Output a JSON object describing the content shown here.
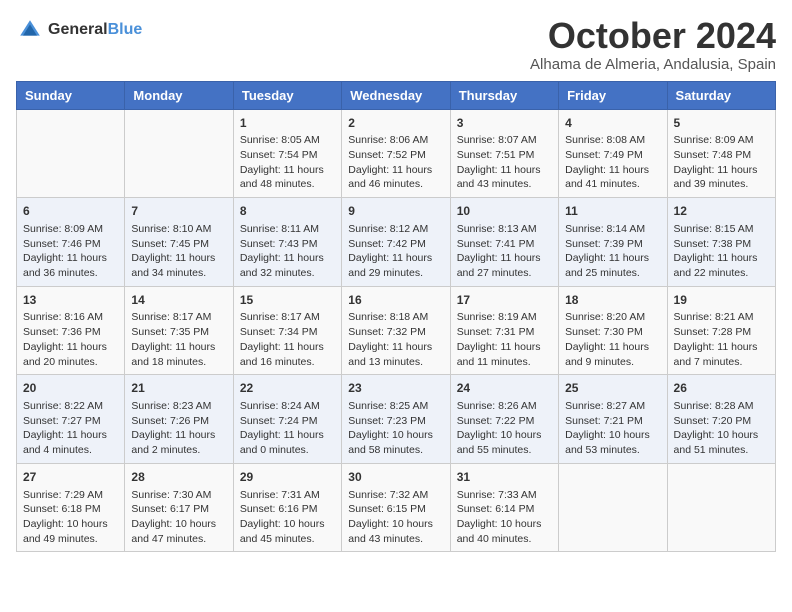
{
  "logo": {
    "line1": "General",
    "line2": "Blue"
  },
  "title": "October 2024",
  "subtitle": "Alhama de Almeria, Andalusia, Spain",
  "days_of_week": [
    "Sunday",
    "Monday",
    "Tuesday",
    "Wednesday",
    "Thursday",
    "Friday",
    "Saturday"
  ],
  "weeks": [
    [
      {
        "day": "",
        "content": ""
      },
      {
        "day": "",
        "content": ""
      },
      {
        "day": "1",
        "content": "Sunrise: 8:05 AM\nSunset: 7:54 PM\nDaylight: 11 hours and 48 minutes."
      },
      {
        "day": "2",
        "content": "Sunrise: 8:06 AM\nSunset: 7:52 PM\nDaylight: 11 hours and 46 minutes."
      },
      {
        "day": "3",
        "content": "Sunrise: 8:07 AM\nSunset: 7:51 PM\nDaylight: 11 hours and 43 minutes."
      },
      {
        "day": "4",
        "content": "Sunrise: 8:08 AM\nSunset: 7:49 PM\nDaylight: 11 hours and 41 minutes."
      },
      {
        "day": "5",
        "content": "Sunrise: 8:09 AM\nSunset: 7:48 PM\nDaylight: 11 hours and 39 minutes."
      }
    ],
    [
      {
        "day": "6",
        "content": "Sunrise: 8:09 AM\nSunset: 7:46 PM\nDaylight: 11 hours and 36 minutes."
      },
      {
        "day": "7",
        "content": "Sunrise: 8:10 AM\nSunset: 7:45 PM\nDaylight: 11 hours and 34 minutes."
      },
      {
        "day": "8",
        "content": "Sunrise: 8:11 AM\nSunset: 7:43 PM\nDaylight: 11 hours and 32 minutes."
      },
      {
        "day": "9",
        "content": "Sunrise: 8:12 AM\nSunset: 7:42 PM\nDaylight: 11 hours and 29 minutes."
      },
      {
        "day": "10",
        "content": "Sunrise: 8:13 AM\nSunset: 7:41 PM\nDaylight: 11 hours and 27 minutes."
      },
      {
        "day": "11",
        "content": "Sunrise: 8:14 AM\nSunset: 7:39 PM\nDaylight: 11 hours and 25 minutes."
      },
      {
        "day": "12",
        "content": "Sunrise: 8:15 AM\nSunset: 7:38 PM\nDaylight: 11 hours and 22 minutes."
      }
    ],
    [
      {
        "day": "13",
        "content": "Sunrise: 8:16 AM\nSunset: 7:36 PM\nDaylight: 11 hours and 20 minutes."
      },
      {
        "day": "14",
        "content": "Sunrise: 8:17 AM\nSunset: 7:35 PM\nDaylight: 11 hours and 18 minutes."
      },
      {
        "day": "15",
        "content": "Sunrise: 8:17 AM\nSunset: 7:34 PM\nDaylight: 11 hours and 16 minutes."
      },
      {
        "day": "16",
        "content": "Sunrise: 8:18 AM\nSunset: 7:32 PM\nDaylight: 11 hours and 13 minutes."
      },
      {
        "day": "17",
        "content": "Sunrise: 8:19 AM\nSunset: 7:31 PM\nDaylight: 11 hours and 11 minutes."
      },
      {
        "day": "18",
        "content": "Sunrise: 8:20 AM\nSunset: 7:30 PM\nDaylight: 11 hours and 9 minutes."
      },
      {
        "day": "19",
        "content": "Sunrise: 8:21 AM\nSunset: 7:28 PM\nDaylight: 11 hours and 7 minutes."
      }
    ],
    [
      {
        "day": "20",
        "content": "Sunrise: 8:22 AM\nSunset: 7:27 PM\nDaylight: 11 hours and 4 minutes."
      },
      {
        "day": "21",
        "content": "Sunrise: 8:23 AM\nSunset: 7:26 PM\nDaylight: 11 hours and 2 minutes."
      },
      {
        "day": "22",
        "content": "Sunrise: 8:24 AM\nSunset: 7:24 PM\nDaylight: 11 hours and 0 minutes."
      },
      {
        "day": "23",
        "content": "Sunrise: 8:25 AM\nSunset: 7:23 PM\nDaylight: 10 hours and 58 minutes."
      },
      {
        "day": "24",
        "content": "Sunrise: 8:26 AM\nSunset: 7:22 PM\nDaylight: 10 hours and 55 minutes."
      },
      {
        "day": "25",
        "content": "Sunrise: 8:27 AM\nSunset: 7:21 PM\nDaylight: 10 hours and 53 minutes."
      },
      {
        "day": "26",
        "content": "Sunrise: 8:28 AM\nSunset: 7:20 PM\nDaylight: 10 hours and 51 minutes."
      }
    ],
    [
      {
        "day": "27",
        "content": "Sunrise: 7:29 AM\nSunset: 6:18 PM\nDaylight: 10 hours and 49 minutes."
      },
      {
        "day": "28",
        "content": "Sunrise: 7:30 AM\nSunset: 6:17 PM\nDaylight: 10 hours and 47 minutes."
      },
      {
        "day": "29",
        "content": "Sunrise: 7:31 AM\nSunset: 6:16 PM\nDaylight: 10 hours and 45 minutes."
      },
      {
        "day": "30",
        "content": "Sunrise: 7:32 AM\nSunset: 6:15 PM\nDaylight: 10 hours and 43 minutes."
      },
      {
        "day": "31",
        "content": "Sunrise: 7:33 AM\nSunset: 6:14 PM\nDaylight: 10 hours and 40 minutes."
      },
      {
        "day": "",
        "content": ""
      },
      {
        "day": "",
        "content": ""
      }
    ]
  ]
}
